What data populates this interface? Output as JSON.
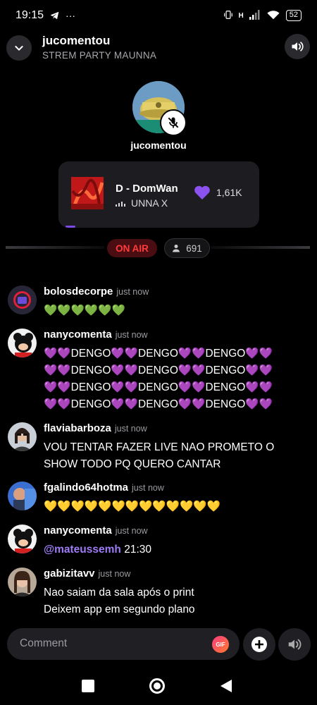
{
  "status_bar": {
    "time": "19:15",
    "more": "···",
    "network": "H",
    "battery": "52"
  },
  "header": {
    "title": "jucomentou",
    "subtitle": "STREM PARTY MAUNNA"
  },
  "host": {
    "name": "jucomentou"
  },
  "music": {
    "title": "D - DomWan",
    "artist": "UNNA X",
    "likes": "1,61K"
  },
  "live": {
    "on_air_label": "ON AIR",
    "viewers": "691"
  },
  "comments": [
    {
      "user": "bolosdecorpe",
      "time": "just now",
      "lines": [
        "💚💚💚💚💚💚"
      ]
    },
    {
      "user": "nanycomenta",
      "time": "just now",
      "lines": [
        "💜💜DENGO💜💜DENGO💜💜DENGO💜💜",
        "💜💜DENGO💜💜DENGO💜💜DENGO💜💜",
        "💜💜DENGO💜💜DENGO💜💜DENGO💜💜",
        "💜💜DENGO💜💜DENGO💜💜DENGO💜💜"
      ]
    },
    {
      "user": "flaviabarboza",
      "time": "just now",
      "lines": [
        "VOU TENTAR FAZER LIVE NAO PROMETO O",
        "SHOW TODO PQ QUERO CANTAR"
      ]
    },
    {
      "user": "fgalindo64hotma",
      "time": "just now",
      "lines": [
        "💛💛💛💛💛💛💛💛💛💛💛💛💛"
      ]
    },
    {
      "user": "nanycomenta",
      "time": "just now",
      "mention": "@mateussemh",
      "after_mention": "21:30"
    },
    {
      "user": "gabizitavv",
      "time": "just now",
      "lines": [
        "Nao saiam da sala após o print",
        "Deixem app em segundo plano"
      ]
    }
  ],
  "composer": {
    "placeholder": "Comment",
    "gif_label": "GIF"
  },
  "colors": {
    "accent": "#7a4be6",
    "on_air": "#ff3b3b",
    "mention": "#9d7cf5"
  }
}
